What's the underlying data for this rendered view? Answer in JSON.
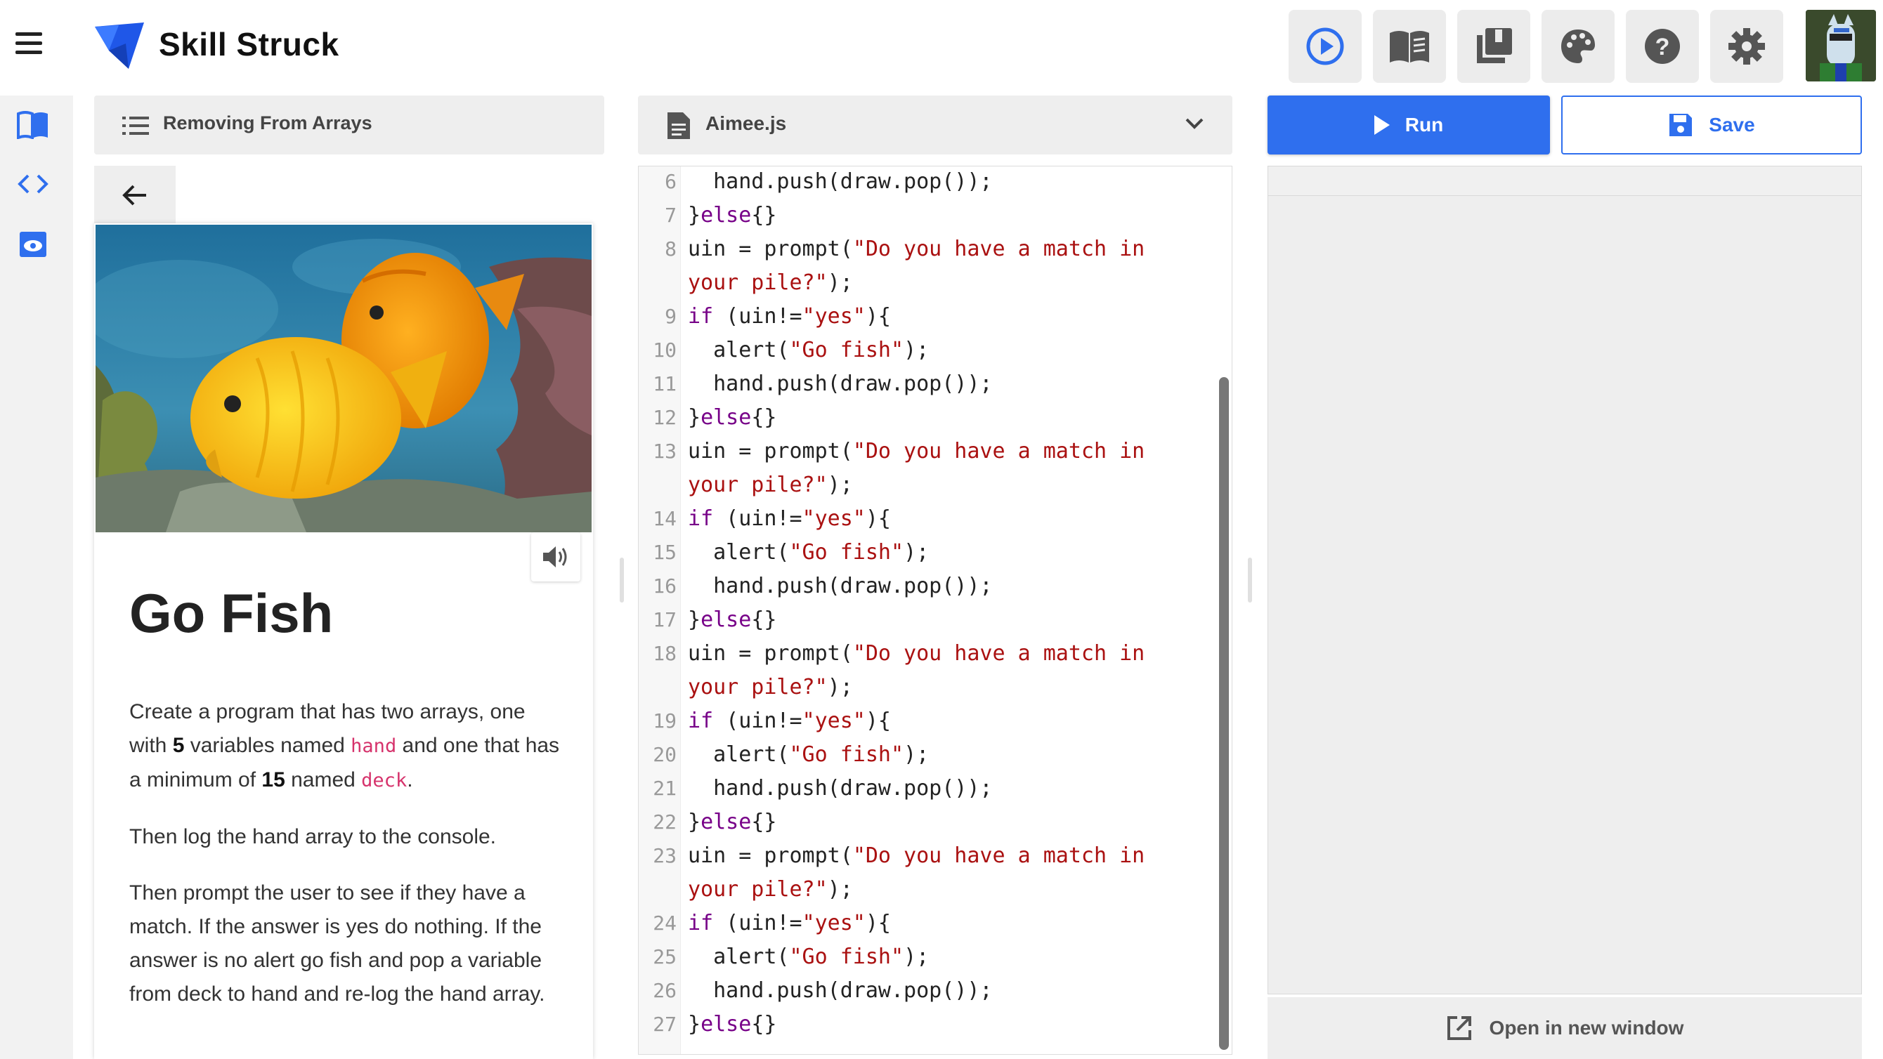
{
  "header": {
    "brand": "Skill Struck",
    "tools": [
      "play-circle-icon",
      "book-open-icon",
      "library-icon",
      "palette-icon",
      "help-icon",
      "gear-icon"
    ]
  },
  "lesson": {
    "header_title": "Removing From Arrays",
    "title": "Go Fish",
    "p1_a": "Create a program that has two arrays, one with ",
    "p1_num1": "5",
    "p1_b": " variables named ",
    "p1_code1": "hand",
    "p1_c": " and one that has a minimum of ",
    "p1_num2": "15",
    "p1_d": " named ",
    "p1_code2": "deck",
    "p1_e": ".",
    "p2": "Then log the hand array to the console.",
    "p3": "Then prompt the user to see if they have a match. If the answer is yes do nothing. If the answer is no alert go fish and pop a variable from deck to hand and re-log the hand array."
  },
  "editor": {
    "filename": "Aimee.js",
    "lines": [
      {
        "n": "6",
        "parts": [
          [
            "",
            "  hand.push(draw.pop());"
          ]
        ]
      },
      {
        "n": "7",
        "parts": [
          [
            "",
            "}"
          ],
          [
            "kw",
            "else"
          ],
          [
            "",
            "{}"
          ]
        ]
      },
      {
        "n": "8",
        "parts": [
          [
            "",
            "uin = prompt("
          ],
          [
            "str",
            "\"Do you have a match in"
          ]
        ]
      },
      {
        "n": "",
        "parts": [
          [
            "str",
            "your pile?\""
          ],
          [
            "",
            ");"
          ]
        ]
      },
      {
        "n": "9",
        "parts": [
          [
            "kw",
            "if"
          ],
          [
            "",
            " (uin!="
          ],
          [
            "str",
            "\"yes\""
          ],
          [
            "",
            "){"
          ]
        ]
      },
      {
        "n": "10",
        "parts": [
          [
            "",
            "  alert("
          ],
          [
            "str",
            "\"Go fish\""
          ],
          [
            "",
            ");"
          ]
        ]
      },
      {
        "n": "11",
        "parts": [
          [
            "",
            "  hand.push(draw.pop());"
          ]
        ]
      },
      {
        "n": "12",
        "parts": [
          [
            "",
            "}"
          ],
          [
            "kw",
            "else"
          ],
          [
            "",
            "{}"
          ]
        ]
      },
      {
        "n": "13",
        "parts": [
          [
            "",
            "uin = prompt("
          ],
          [
            "str",
            "\"Do you have a match in"
          ]
        ]
      },
      {
        "n": "",
        "parts": [
          [
            "str",
            "your pile?\""
          ],
          [
            "",
            ");"
          ]
        ]
      },
      {
        "n": "14",
        "parts": [
          [
            "kw",
            "if"
          ],
          [
            "",
            " (uin!="
          ],
          [
            "str",
            "\"yes\""
          ],
          [
            "",
            "){"
          ]
        ]
      },
      {
        "n": "15",
        "parts": [
          [
            "",
            "  alert("
          ],
          [
            "str",
            "\"Go fish\""
          ],
          [
            "",
            ");"
          ]
        ]
      },
      {
        "n": "16",
        "parts": [
          [
            "",
            "  hand.push(draw.pop());"
          ]
        ]
      },
      {
        "n": "17",
        "parts": [
          [
            "",
            "}"
          ],
          [
            "kw",
            "else"
          ],
          [
            "",
            "{}"
          ]
        ]
      },
      {
        "n": "18",
        "parts": [
          [
            "",
            "uin = prompt("
          ],
          [
            "str",
            "\"Do you have a match in"
          ]
        ]
      },
      {
        "n": "",
        "parts": [
          [
            "str",
            "your pile?\""
          ],
          [
            "",
            ");"
          ]
        ]
      },
      {
        "n": "19",
        "parts": [
          [
            "kw",
            "if"
          ],
          [
            "",
            " (uin!="
          ],
          [
            "str",
            "\"yes\""
          ],
          [
            "",
            "){"
          ]
        ]
      },
      {
        "n": "20",
        "parts": [
          [
            "",
            "  alert("
          ],
          [
            "str",
            "\"Go fish\""
          ],
          [
            "",
            ");"
          ]
        ]
      },
      {
        "n": "21",
        "parts": [
          [
            "",
            "  hand.push(draw.pop());"
          ]
        ]
      },
      {
        "n": "22",
        "parts": [
          [
            "",
            "}"
          ],
          [
            "kw",
            "else"
          ],
          [
            "",
            "{}"
          ]
        ]
      },
      {
        "n": "23",
        "parts": [
          [
            "",
            "uin = prompt("
          ],
          [
            "str",
            "\"Do you have a match in"
          ]
        ]
      },
      {
        "n": "",
        "parts": [
          [
            "str",
            "your pile?\""
          ],
          [
            "",
            ");"
          ]
        ]
      },
      {
        "n": "24",
        "parts": [
          [
            "kw",
            "if"
          ],
          [
            "",
            " (uin!="
          ],
          [
            "str",
            "\"yes\""
          ],
          [
            "",
            "){"
          ]
        ]
      },
      {
        "n": "25",
        "parts": [
          [
            "",
            "  alert("
          ],
          [
            "str",
            "\"Go fish\""
          ],
          [
            "",
            ");"
          ]
        ]
      },
      {
        "n": "26",
        "parts": [
          [
            "",
            "  hand.push(draw.pop());"
          ]
        ]
      },
      {
        "n": "27",
        "parts": [
          [
            "",
            "}"
          ],
          [
            "kw",
            "else"
          ],
          [
            "",
            "{}"
          ]
        ]
      }
    ]
  },
  "actions": {
    "run_label": "Run",
    "save_label": "Save",
    "open_window_label": "Open in new window"
  },
  "colors": {
    "accent": "#2f6fee",
    "keyword": "#770088",
    "string": "#aa1111",
    "inline_code": "#d6336c"
  }
}
